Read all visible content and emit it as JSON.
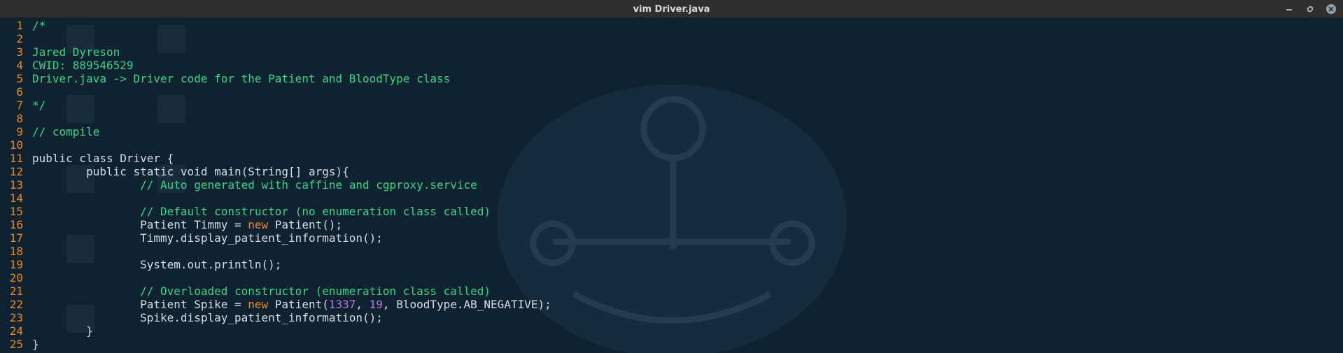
{
  "window": {
    "title": "vim Driver.java",
    "controls": {
      "minimize_icon": "minimize-icon",
      "maximize_icon": "restore-icon",
      "close_icon": "close-icon"
    }
  },
  "colors": {
    "background": "#0f2230",
    "line_number": "#f0871c",
    "comment": "#39d48a",
    "code": "#d4dde6",
    "keyword_new": "#f0871c",
    "number": "#b77be0"
  },
  "editor": {
    "lines": [
      {
        "num": "1",
        "tokens": [
          {
            "t": "/*",
            "k": "comment"
          }
        ]
      },
      {
        "num": "2",
        "tokens": []
      },
      {
        "num": "3",
        "tokens": [
          {
            "t": "Jared Dyreson",
            "k": "comment"
          }
        ]
      },
      {
        "num": "4",
        "tokens": [
          {
            "t": "CWID: 889546529",
            "k": "comment"
          }
        ]
      },
      {
        "num": "5",
        "tokens": [
          {
            "t": "Driver.java -> Driver code for the Patient and BloodType class",
            "k": "comment"
          }
        ]
      },
      {
        "num": "6",
        "tokens": []
      },
      {
        "num": "7",
        "tokens": [
          {
            "t": "*/",
            "k": "comment"
          }
        ]
      },
      {
        "num": "8",
        "tokens": []
      },
      {
        "num": "9",
        "tokens": [
          {
            "t": "// compile",
            "k": "comment"
          }
        ]
      },
      {
        "num": "10",
        "tokens": []
      },
      {
        "num": "11",
        "tokens": [
          {
            "t": "public class Driver {",
            "k": "plain"
          }
        ]
      },
      {
        "num": "12",
        "tokens": [
          {
            "t": "        public static void main(String[] args){",
            "k": "plain"
          }
        ]
      },
      {
        "num": "13",
        "tokens": [
          {
            "t": "                ",
            "k": "plain"
          },
          {
            "t": "// Auto generated with caffine and cgproxy.service",
            "k": "comment"
          }
        ]
      },
      {
        "num": "14",
        "tokens": []
      },
      {
        "num": "15",
        "tokens": [
          {
            "t": "                ",
            "k": "plain"
          },
          {
            "t": "// Default constructor (no enumeration class called)",
            "k": "comment"
          }
        ]
      },
      {
        "num": "16",
        "tokens": [
          {
            "t": "                Patient Timmy = ",
            "k": "plain"
          },
          {
            "t": "new",
            "k": "new"
          },
          {
            "t": " Patient();",
            "k": "plain"
          }
        ]
      },
      {
        "num": "17",
        "tokens": [
          {
            "t": "                Timmy.display_patient_information();",
            "k": "plain"
          }
        ]
      },
      {
        "num": "18",
        "tokens": []
      },
      {
        "num": "19",
        "tokens": [
          {
            "t": "                System.out.println();",
            "k": "plain"
          }
        ]
      },
      {
        "num": "20",
        "tokens": []
      },
      {
        "num": "21",
        "tokens": [
          {
            "t": "                ",
            "k": "plain"
          },
          {
            "t": "// Overloaded constructor (enumeration class called)",
            "k": "comment"
          }
        ]
      },
      {
        "num": "22",
        "tokens": [
          {
            "t": "                Patient Spike = ",
            "k": "plain"
          },
          {
            "t": "new",
            "k": "new"
          },
          {
            "t": " Patient(",
            "k": "plain"
          },
          {
            "t": "1337",
            "k": "number"
          },
          {
            "t": ", ",
            "k": "plain"
          },
          {
            "t": "19",
            "k": "number"
          },
          {
            "t": ", BloodType.AB_NEGATIVE);",
            "k": "plain"
          }
        ]
      },
      {
        "num": "23",
        "tokens": [
          {
            "t": "                Spike.display_patient_information();",
            "k": "plain"
          }
        ]
      },
      {
        "num": "24",
        "tokens": [
          {
            "t": "        }",
            "k": "plain"
          }
        ]
      },
      {
        "num": "25",
        "tokens": [
          {
            "t": "}",
            "k": "plain"
          }
        ]
      }
    ]
  }
}
